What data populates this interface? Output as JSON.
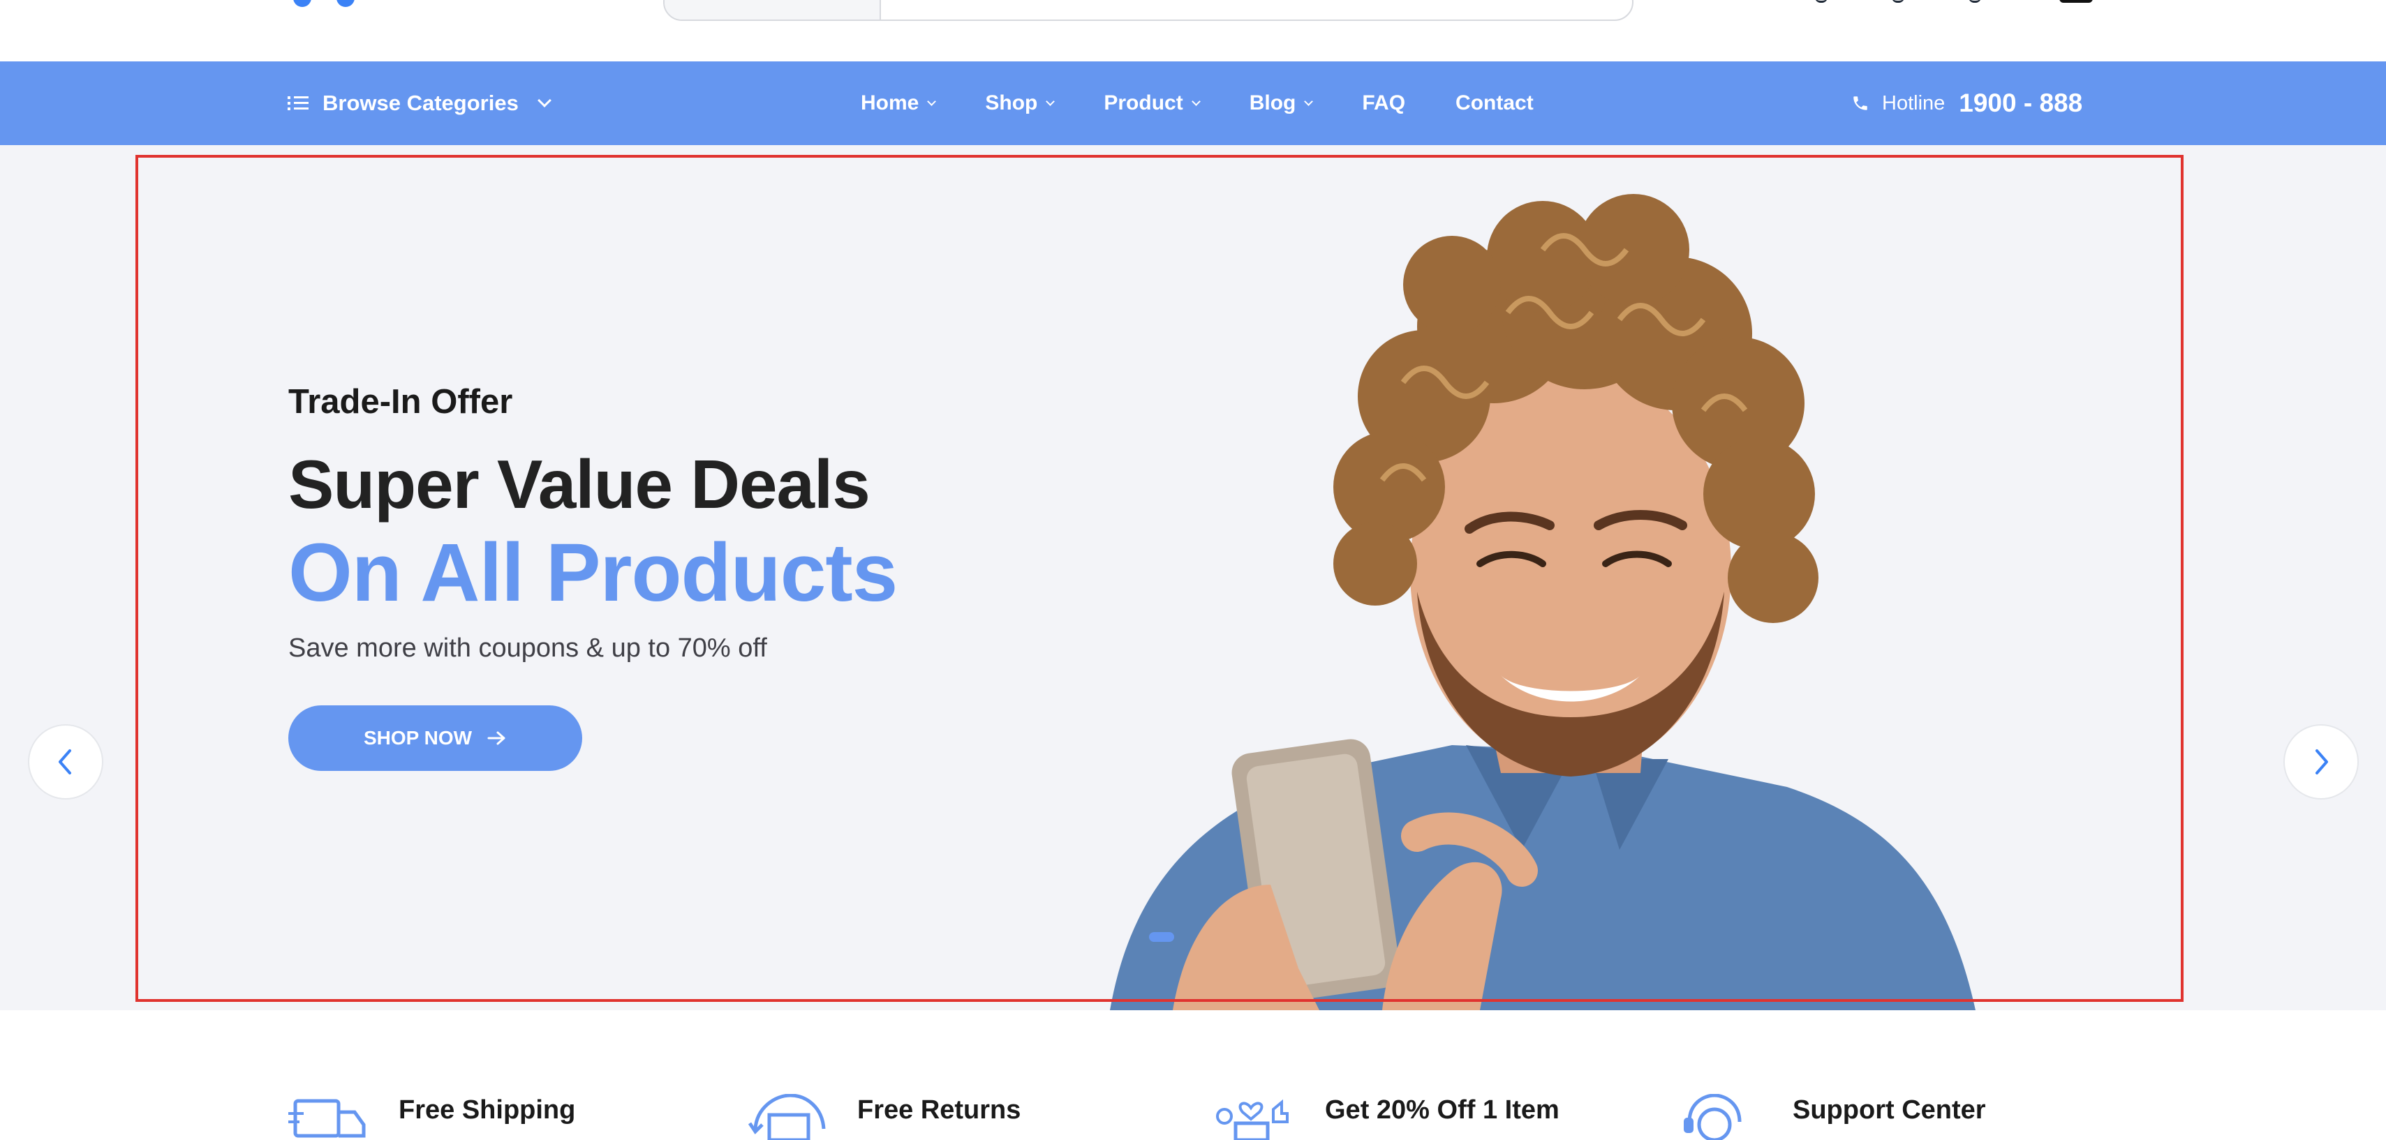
{
  "header": {
    "search_placeholder": "",
    "icons": [
      "logo-icon",
      "compare-icon",
      "wishlist-icon",
      "cart-icon",
      "account-icon"
    ]
  },
  "nav": {
    "browse_label": "Browse Categories",
    "links": [
      {
        "label": "Home",
        "dropdown": true
      },
      {
        "label": "Shop",
        "dropdown": true
      },
      {
        "label": "Product",
        "dropdown": true
      },
      {
        "label": "Blog",
        "dropdown": true
      },
      {
        "label": "FAQ",
        "dropdown": false
      },
      {
        "label": "Contact",
        "dropdown": false
      }
    ],
    "hotline_label": "Hotline",
    "hotline_number": "1900 - 888"
  },
  "hero": {
    "kicker": "Trade-In Offer",
    "headline_line1": "Super Value Deals",
    "headline_line2": "On All Products",
    "subline": "Save more with coupons & up to 70% off",
    "cta_label": "SHOP NOW",
    "slides": 2,
    "active_slide": 1
  },
  "features": [
    {
      "title": "Free Shipping",
      "icon": "truck-icon"
    },
    {
      "title": "Free Returns",
      "icon": "returns-box-icon"
    },
    {
      "title": "Get 20% Off 1 Item",
      "icon": "gift-discount-icon"
    },
    {
      "title": "Support Center",
      "icon": "support-agent-icon"
    }
  ],
  "colors": {
    "accent": "#6596f0",
    "hero_bg": "#f3f4f8",
    "highlight_frame": "#e0332f",
    "text_dark": "#222222"
  }
}
